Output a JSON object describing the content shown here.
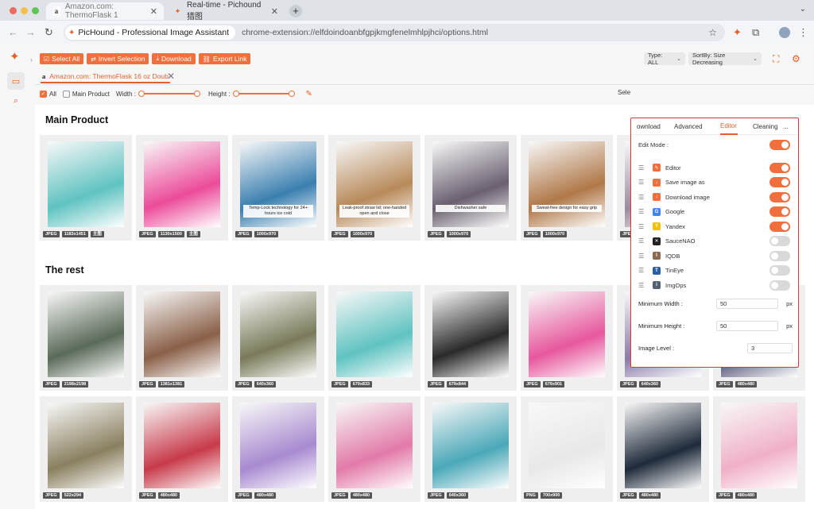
{
  "browser": {
    "tabs": [
      {
        "title": "Amazon.com: ThermoFlask 1",
        "close": "✕"
      },
      {
        "title": "Real-time - Pichound 猎图",
        "close": "✕"
      }
    ],
    "new_tab": "+",
    "site_chip": "PicHound - Professional Image Assistant",
    "url": "chrome-extension://elfdoindoanbfgpjkmgfenelmhlpjhci/options.html"
  },
  "app": {
    "actions": [
      {
        "label": "Select All",
        "icon": "select-icon"
      },
      {
        "label": "Invert Selection",
        "icon": "invert-icon"
      },
      {
        "label": "Download",
        "icon": "download-icon"
      },
      {
        "label": "Export Link",
        "icon": "link-icon"
      }
    ],
    "type_select": "Type: ALL",
    "sort_select": "SortBy: Size Decreasing",
    "page_tab": "Amazon.com: ThermoFlask 16 oz Doub",
    "filters": {
      "all": "All",
      "main_product": "Main Product",
      "width": "Width :",
      "height": "Height :",
      "right_label": "Sele"
    },
    "sections": [
      {
        "title": "Main Product"
      },
      {
        "title": "The rest"
      }
    ]
  },
  "images": {
    "main": [
      {
        "format": "JPEG",
        "size": "1183x1451",
        "badge": "主图",
        "caption": "",
        "color": "#5fc3c1"
      },
      {
        "format": "JPEG",
        "size": "1130x1500",
        "badge": "主图",
        "caption": "",
        "color": "#ec4b9a"
      },
      {
        "format": "JPEG",
        "size": "1000x970",
        "badge": "",
        "caption": "Temp-Lock technology for 24+ hours ice cold",
        "color": "#3a7fb0"
      },
      {
        "format": "JPEG",
        "size": "1000x970",
        "badge": "",
        "caption": "Leak-proof straw lid; one-handed open and close",
        "color": "#b88a5a"
      },
      {
        "format": "JPEG",
        "size": "1000x970",
        "badge": "",
        "caption": "Dishwasher safe",
        "color": "#6a6070"
      },
      {
        "format": "JPEG",
        "size": "1000x970",
        "badge": "",
        "caption": "Sweat-free design for easy grip",
        "color": "#b07848"
      },
      {
        "format": "JPEG",
        "size": "1000x970",
        "badge": "",
        "caption": "",
        "color": "#9a8aa0"
      }
    ],
    "rest_row1": [
      {
        "format": "JPEG",
        "size": "2198x2198",
        "color": "#5a6a58"
      },
      {
        "format": "JPEG",
        "size": "1381x1381",
        "color": "#8a6048"
      },
      {
        "format": "JPEG",
        "size": "640x360",
        "color": "#7a7a5a"
      },
      {
        "format": "JPEG",
        "size": "679x833",
        "color": "#5fc3c1"
      },
      {
        "format": "JPEG",
        "size": "679x844",
        "color": "#2a2a2a"
      },
      {
        "format": "JPEG",
        "size": "679x901",
        "color": "#e7579d"
      },
      {
        "format": "JPEG",
        "size": "640x360",
        "color": "#8a7aa8"
      },
      {
        "format": "JPEG",
        "size": "480x480",
        "color": "#4a4a70"
      }
    ],
    "rest_row2": [
      {
        "format": "JPEG",
        "size": "522x294",
        "color": "#8a8060"
      },
      {
        "format": "JPEG",
        "size": "480x480",
        "color": "#c83a4a"
      },
      {
        "format": "JPEG",
        "size": "480x480",
        "color": "#a88ad0"
      },
      {
        "format": "JPEG",
        "size": "480x480",
        "color": "#e27aa8"
      },
      {
        "format": "JPEG",
        "size": "640x360",
        "color": "#4aa8b8"
      },
      {
        "format": "PNG",
        "size": "700x900",
        "color": "#e8e8e8"
      },
      {
        "format": "JPEG",
        "size": "480x480",
        "color": "#1e2a3a"
      },
      {
        "format": "JPEG",
        "size": "480x480",
        "color": "#f0b0c8"
      }
    ]
  },
  "panel": {
    "tabs": [
      "ownload",
      "Advanced",
      "Editor",
      "Cleaning",
      "..."
    ],
    "active_tab": "Editor",
    "edit_mode": "Edit Mode :",
    "services": [
      {
        "name": "Editor",
        "on": true,
        "color": "#f06f3c",
        "glyph": "✎"
      },
      {
        "name": "Save image as",
        "on": true,
        "color": "#f06f3c",
        "glyph": "↓"
      },
      {
        "name": "Download image",
        "on": true,
        "color": "#f06f3c",
        "glyph": "↓"
      },
      {
        "name": "Google",
        "on": true,
        "color": "#4285f4",
        "glyph": "G"
      },
      {
        "name": "Yandex",
        "on": true,
        "color": "#f2c200",
        "glyph": "Y"
      },
      {
        "name": "SauceNAO",
        "on": false,
        "color": "#222222",
        "glyph": "✕"
      },
      {
        "name": "IQDB",
        "on": false,
        "color": "#8a6a50",
        "glyph": "I"
      },
      {
        "name": "TinEye",
        "on": false,
        "color": "#2a5fa8",
        "glyph": "T"
      },
      {
        "name": "ImgOps",
        "on": false,
        "color": "#556070",
        "glyph": "i"
      }
    ],
    "min_width_label": "Minimum Width :",
    "min_width": "50",
    "min_height_label": "Minimum Height :",
    "min_height": "50",
    "unit": "px",
    "image_level_label": "Image Level :",
    "image_level": "3"
  }
}
